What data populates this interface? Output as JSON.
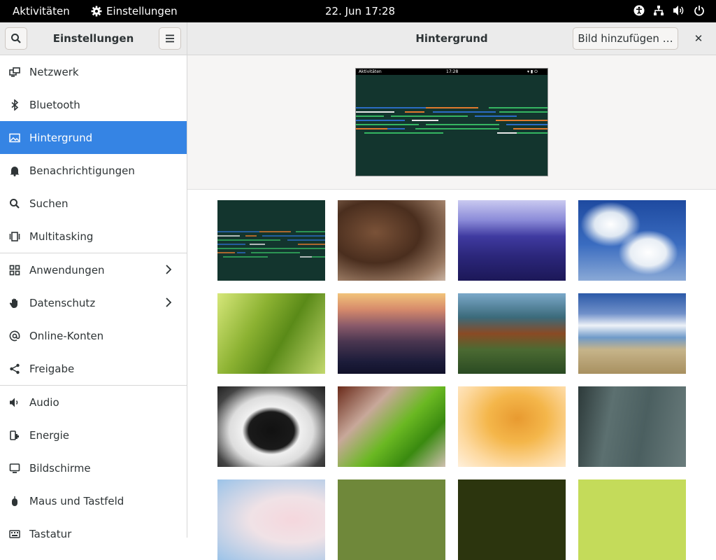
{
  "topbar": {
    "activities": "Aktivitäten",
    "app_name": "Einstellungen",
    "clock": "22. Jun  17:28",
    "tray_icons": [
      "accessibility-icon",
      "network-wired-icon",
      "volume-icon",
      "power-icon"
    ]
  },
  "sidebar": {
    "title": "Einstellungen",
    "items": [
      {
        "label": "Netzwerk",
        "icon": "network-icon"
      },
      {
        "label": "Bluetooth",
        "icon": "bluetooth-icon"
      },
      {
        "label": "Hintergrund",
        "icon": "background-icon",
        "active": true
      },
      {
        "label": "Benachrichtigungen",
        "icon": "bell-icon"
      },
      {
        "label": "Suchen",
        "icon": "search-icon"
      },
      {
        "label": "Multitasking",
        "icon": "multitasking-icon"
      },
      {
        "label": "Anwendungen",
        "icon": "apps-icon",
        "submenu": true
      },
      {
        "label": "Datenschutz",
        "icon": "hand-icon",
        "submenu": true
      },
      {
        "label": "Online-Konten",
        "icon": "at-icon"
      },
      {
        "label": "Freigabe",
        "icon": "share-icon"
      },
      {
        "label": "Audio",
        "icon": "speaker-icon"
      },
      {
        "label": "Energie",
        "icon": "power-plug-icon"
      },
      {
        "label": "Bildschirme",
        "icon": "display-icon"
      },
      {
        "label": "Maus und Tastfeld",
        "icon": "mouse-icon"
      },
      {
        "label": "Tastatur",
        "icon": "keyboard-icon"
      }
    ]
  },
  "header": {
    "title": "Hintergrund",
    "add_button": "Bild hinzufügen …",
    "close": "✕"
  },
  "preview": {
    "bar_left": "Aktivitäten",
    "bar_clock": "17:28"
  },
  "colors": {
    "accent": "#3584e4",
    "topbar": "#000000",
    "header_bg": "#ebebeb",
    "preview_bg": "#13352e"
  },
  "wallpapers": [
    "opensuse-lines",
    "bear",
    "moeraki-boulders",
    "clouds-sky",
    "green-leaf",
    "purple-mountains",
    "autumn-hills",
    "cloudy-lake",
    "sleeping-monkey",
    "green-petal",
    "orange-flower",
    "wire-fence",
    "pink-blossom",
    "olive-solid",
    "dark-olive-solid",
    "lime-solid"
  ]
}
